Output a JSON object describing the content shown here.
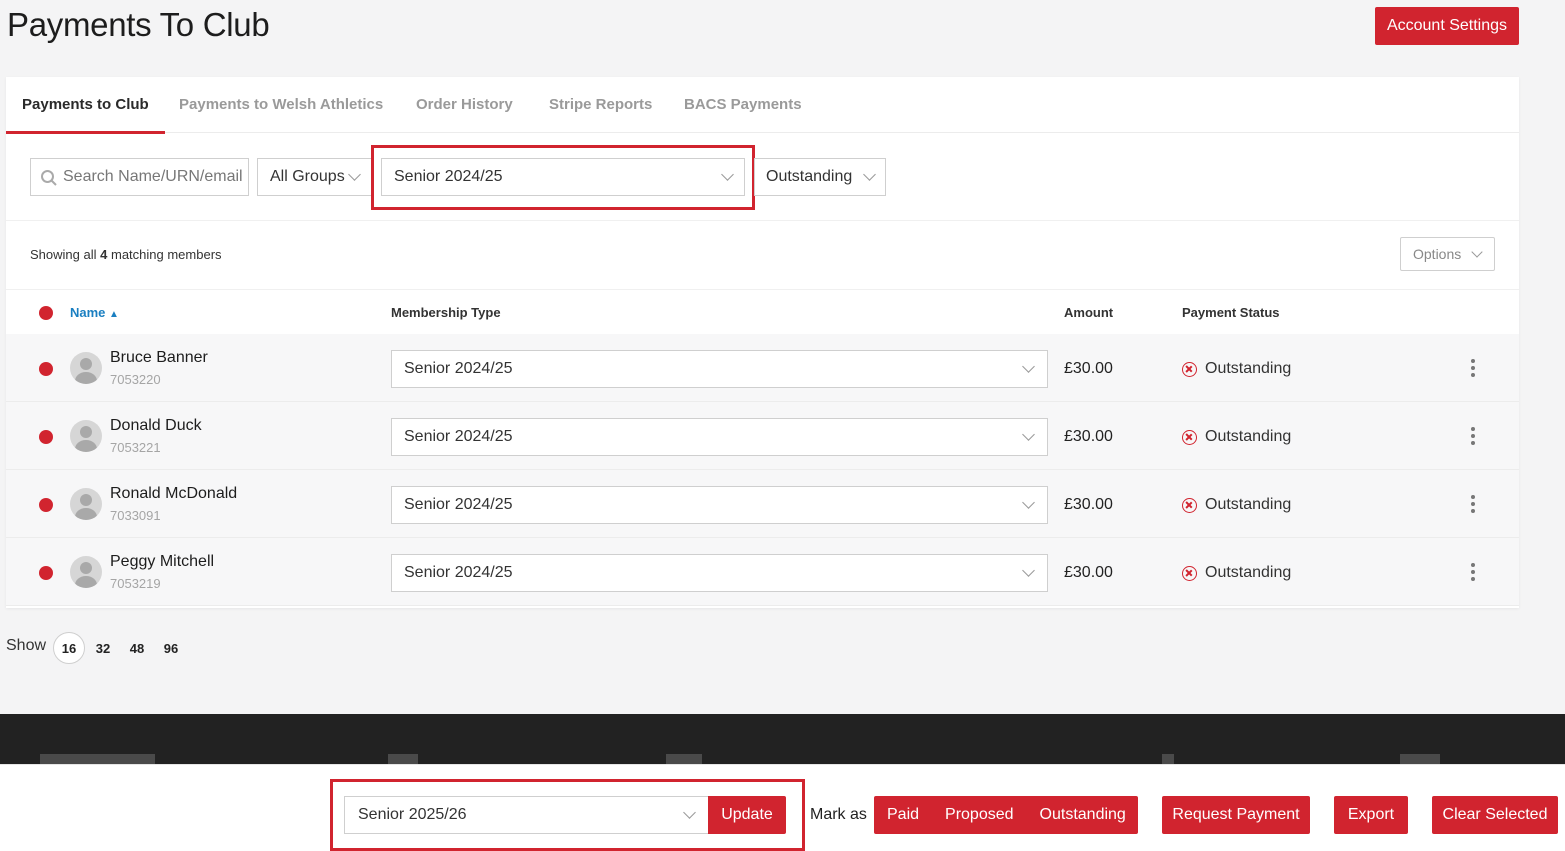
{
  "page": {
    "title": "Payments To Club"
  },
  "header": {
    "account_settings": "Account Settings"
  },
  "tabs": [
    {
      "label": "Payments to Club",
      "active": true
    },
    {
      "label": "Payments to Welsh Athletics",
      "active": false
    },
    {
      "label": "Order History",
      "active": false
    },
    {
      "label": "Stripe Reports",
      "active": false
    },
    {
      "label": "BACS Payments",
      "active": false
    }
  ],
  "filters": {
    "search_placeholder": "Search Name/URN/email",
    "groups": "All Groups",
    "season": "Senior 2024/25",
    "status": "Outstanding"
  },
  "summary": {
    "prefix": "Showing all",
    "count": "4",
    "suffix": "matching members"
  },
  "options_label": "Options",
  "table": {
    "headers": {
      "name": "Name",
      "membership_type": "Membership Type",
      "amount": "Amount",
      "payment_status": "Payment Status"
    },
    "rows": [
      {
        "name": "Bruce Banner",
        "urn": "7053220",
        "membership_type": "Senior 2024/25",
        "amount": "£30.00",
        "status": "Outstanding"
      },
      {
        "name": "Donald Duck",
        "urn": "7053221",
        "membership_type": "Senior 2024/25",
        "amount": "£30.00",
        "status": "Outstanding"
      },
      {
        "name": "Ronald McDonald",
        "urn": "7033091",
        "membership_type": "Senior 2024/25",
        "amount": "£30.00",
        "status": "Outstanding"
      },
      {
        "name": "Peggy Mitchell",
        "urn": "7053219",
        "membership_type": "Senior 2024/25",
        "amount": "£30.00",
        "status": "Outstanding"
      }
    ]
  },
  "pagination": {
    "label": "Show",
    "options": [
      "16",
      "32",
      "48",
      "96"
    ],
    "selected": "16"
  },
  "bottom_bar": {
    "membership_select": "Senior 2025/26",
    "update": "Update",
    "mark_as": "Mark as",
    "mark_options": [
      "Paid",
      "Proposed",
      "Outstanding"
    ],
    "request_payment": "Request Payment",
    "export": "Export",
    "clear_selected": "Clear Selected"
  },
  "colors": {
    "accent": "#d1242f",
    "link": "#1a7fc1",
    "footer": "#222222"
  }
}
